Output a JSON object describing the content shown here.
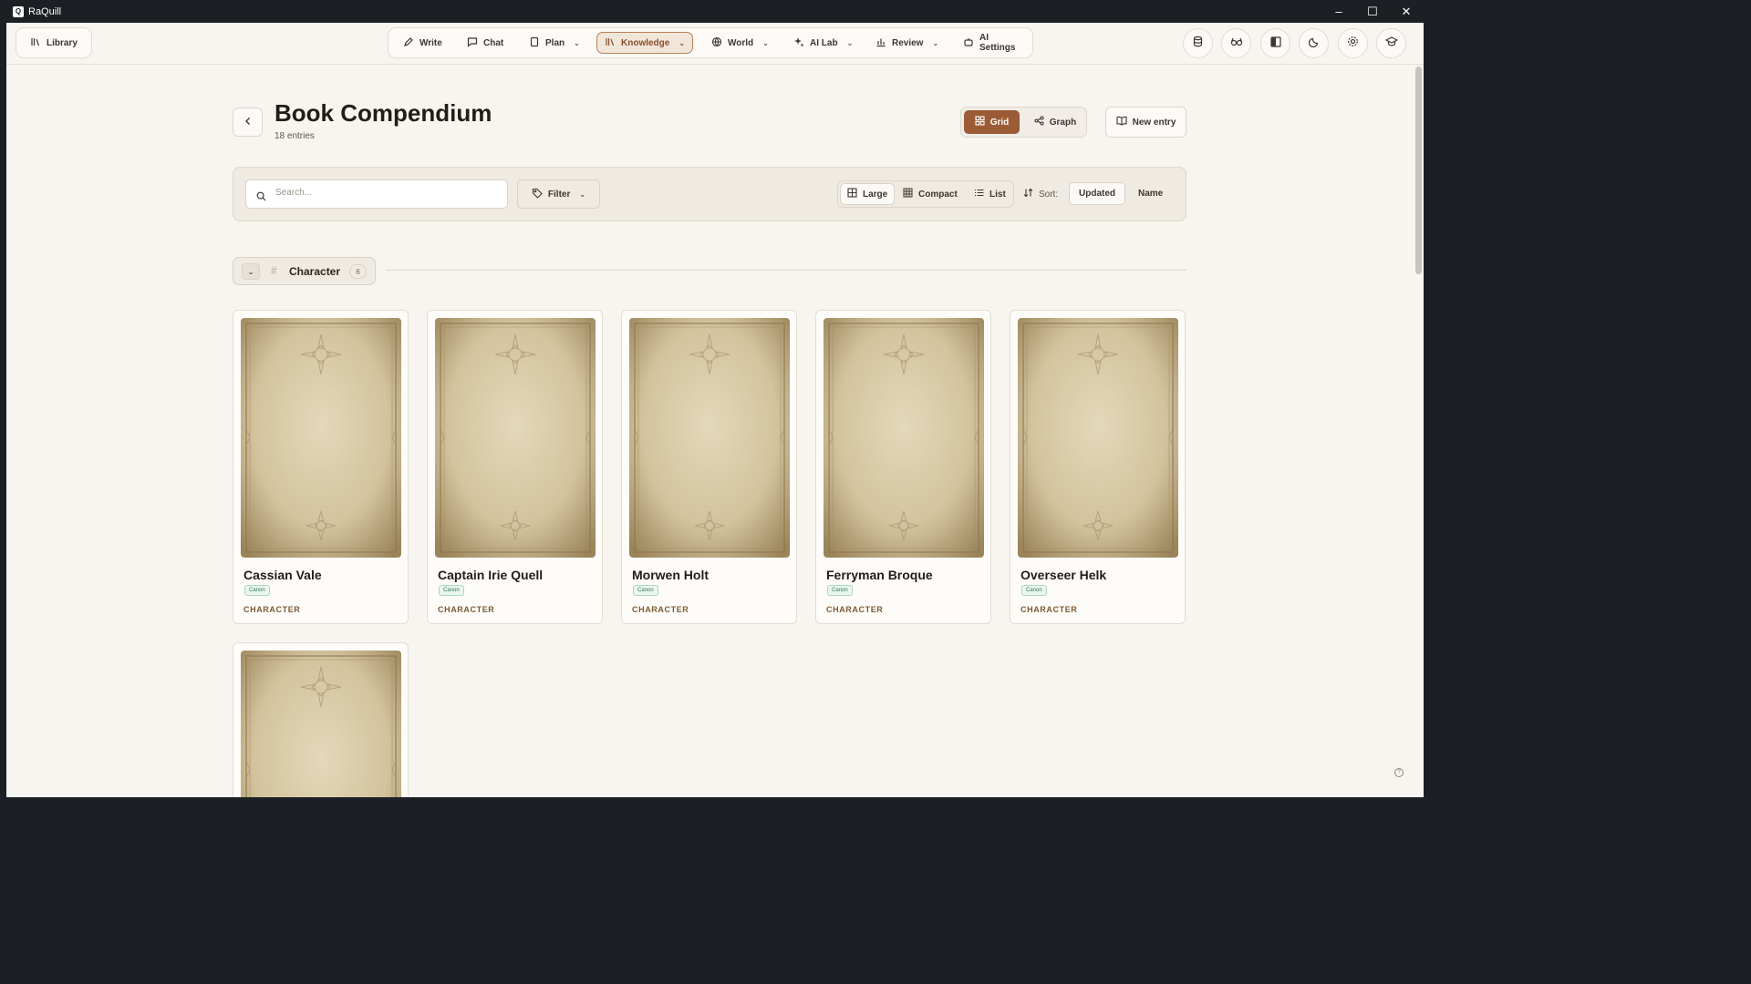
{
  "window": {
    "title": "RaQuill"
  },
  "topnav": {
    "library": "Library",
    "items": [
      {
        "label": "Write",
        "icon": "pen-icon"
      },
      {
        "label": "Chat",
        "icon": "chat-icon"
      },
      {
        "label": "Plan",
        "icon": "book-icon"
      },
      {
        "label": "Knowledge",
        "icon": "books-icon",
        "active": true
      },
      {
        "label": "World",
        "icon": "globe-icon"
      },
      {
        "label": "AI Lab",
        "icon": "sparkle-icon"
      },
      {
        "label": "Review",
        "icon": "chart-icon"
      },
      {
        "label": "AI Settings",
        "icon": "robot-icon"
      }
    ],
    "right_icons": [
      "database-icon",
      "glasses-icon",
      "split-view-icon",
      "moon-icon",
      "gear-icon",
      "graduation-cap-icon"
    ]
  },
  "header": {
    "title": "Book Compendium",
    "subtitle": "18 entries",
    "view_grid": "Grid",
    "view_graph": "Graph",
    "new_entry": "New entry"
  },
  "toolbar": {
    "search_placeholder": "Search...",
    "filter": "Filter",
    "density_large": "Large",
    "density_compact": "Compact",
    "density_list": "List",
    "sort_label": "Sort:",
    "sort_updated": "Updated",
    "sort_name": "Name"
  },
  "group": {
    "name": "Character",
    "count": "6"
  },
  "cards": [
    {
      "name": "Cassian Vale",
      "badge": "Canon",
      "type": "CHARACTER"
    },
    {
      "name": "Captain Irie Quell",
      "badge": "Canon",
      "type": "CHARACTER"
    },
    {
      "name": "Morwen Holt",
      "badge": "Canon",
      "type": "CHARACTER"
    },
    {
      "name": "Ferryman Broque",
      "badge": "Canon",
      "type": "CHARACTER"
    },
    {
      "name": "Overseer Helk",
      "badge": "Canon",
      "type": "CHARACTER"
    },
    {
      "name": "",
      "badge": "",
      "type": ""
    }
  ],
  "colors": {
    "accent": "#9b5c35",
    "background": "#f7f5f0",
    "canon_badge": "#2f7a55",
    "type_label": "#7e5a31"
  }
}
